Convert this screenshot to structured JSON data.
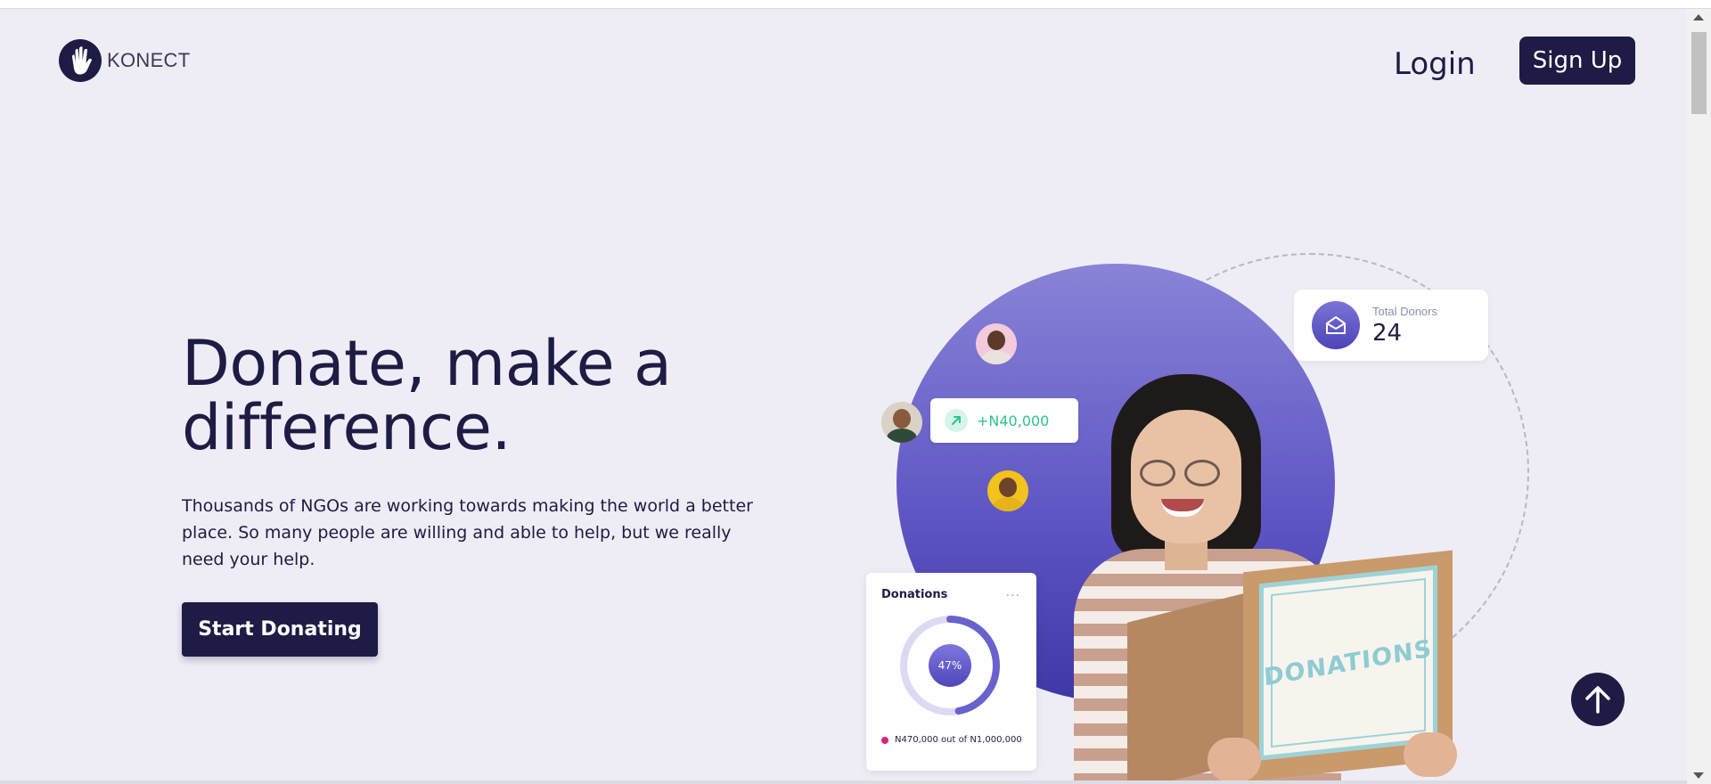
{
  "brand": {
    "name": "KONECT"
  },
  "nav": {
    "login_label": "Login",
    "signup_label": "Sign Up"
  },
  "hero": {
    "title": "Donate, make a difference.",
    "description": "Thousands of NGOs are working towards making the world a better place. So many people are willing and able to help, but we really need your help.",
    "cta_label": "Start Donating"
  },
  "illustration": {
    "amount_badge": "+N40,000",
    "donors_card": {
      "label": "Total Donors",
      "value": "24"
    },
    "donations_card": {
      "title": "Donations",
      "more": "···",
      "percent_label": "47%",
      "progress_fraction": 0.47,
      "legend": "N470,000 out of N1,000,000"
    },
    "box_text": "DONATIONS"
  },
  "colors": {
    "primary": "#1e1b45",
    "background": "#eeedf5",
    "accent_purple": "#5c54c2",
    "positive_green": "#2fc38c",
    "legend_pink": "#e0207a"
  },
  "icons": {
    "logo": "hand-icon",
    "amount": "arrow-up-right-icon",
    "donors": "envelope-open-icon",
    "back_to_top": "arrow-up-icon"
  }
}
